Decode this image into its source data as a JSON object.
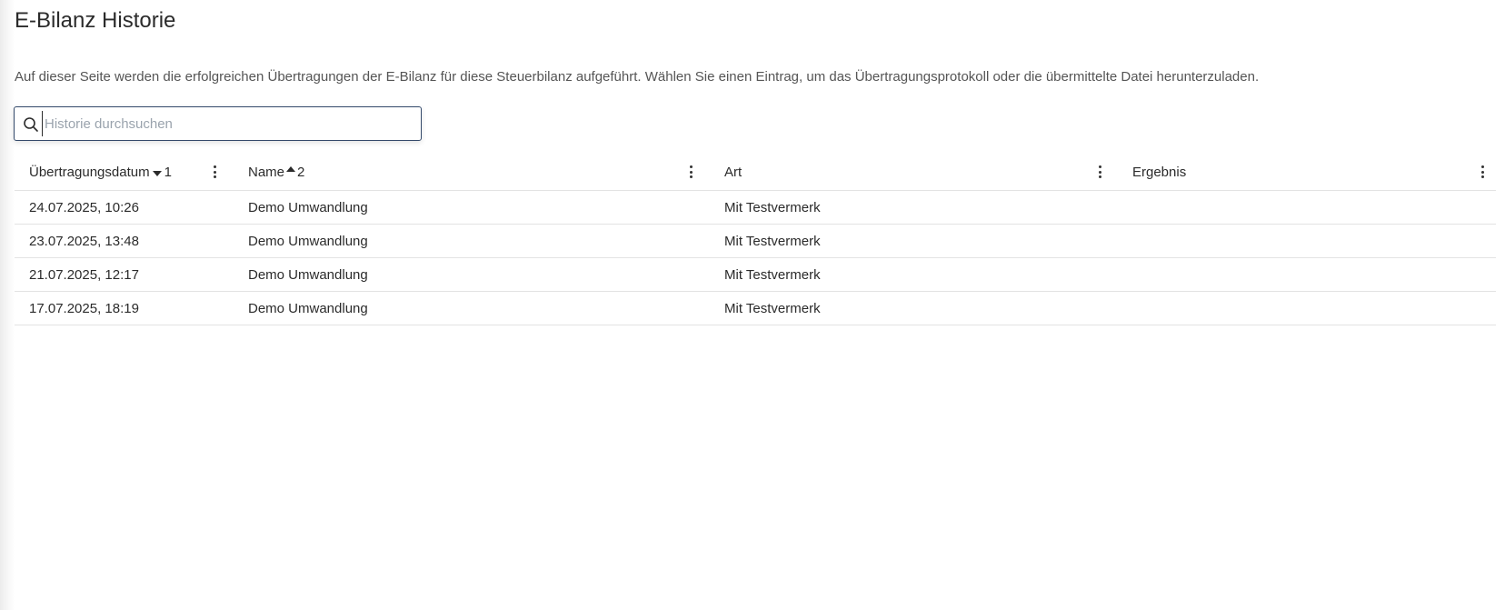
{
  "page": {
    "title": "E-Bilanz Historie",
    "description": "Auf dieser Seite werden die erfolgreichen Übertragungen der E-Bilanz für diese Steuerbilanz aufgeführt. Wählen Sie einen Eintrag, um das Übertragungsprotokoll oder die übermittelte Datei herunterzuladen."
  },
  "search": {
    "placeholder": "Historie durchsuchen",
    "value": "",
    "icon": "search-icon"
  },
  "table": {
    "columns": [
      {
        "label": "Übertragungsdatum",
        "sort_direction": "descending",
        "sort_order": "1",
        "menu_icon": "more-vertical-icon"
      },
      {
        "label": "Name",
        "sort_direction": "ascending",
        "sort_order": "2",
        "menu_icon": "more-vertical-icon"
      },
      {
        "label": "Art",
        "sort_direction": "",
        "sort_order": "",
        "menu_icon": "more-vertical-icon"
      },
      {
        "label": "Ergebnis",
        "sort_direction": "",
        "sort_order": "",
        "menu_icon": "more-vertical-icon"
      }
    ],
    "rows": [
      {
        "date": "24.07.2025, 10:26",
        "name": "Demo Umwandlung",
        "art": "Mit Testvermerk",
        "ergebnis": ""
      },
      {
        "date": "23.07.2025, 13:48",
        "name": "Demo Umwandlung",
        "art": "Mit Testvermerk",
        "ergebnis": ""
      },
      {
        "date": "21.07.2025, 12:17",
        "name": "Demo Umwandlung",
        "art": "Mit Testvermerk",
        "ergebnis": ""
      },
      {
        "date": "17.07.2025, 18:19",
        "name": "Demo Umwandlung",
        "art": "Mit Testvermerk",
        "ergebnis": ""
      }
    ]
  },
  "colors": {
    "search_border": "#344a6b",
    "text": "#2b2b2b",
    "muted_text": "#555555",
    "row_divider": "#e3e3e3"
  }
}
